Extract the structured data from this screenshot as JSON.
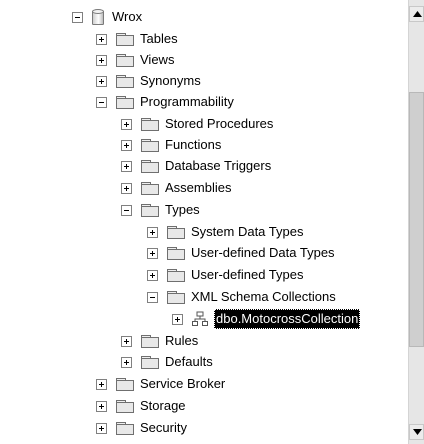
{
  "tree": {
    "root": {
      "label": "Wrox"
    },
    "items": [
      {
        "label": "Tables"
      },
      {
        "label": "Views"
      },
      {
        "label": "Synonyms"
      },
      {
        "label": "Programmability"
      },
      {
        "label": "Stored Procedures"
      },
      {
        "label": "Functions"
      },
      {
        "label": "Database Triggers"
      },
      {
        "label": "Assemblies"
      },
      {
        "label": "Types"
      },
      {
        "label": "System Data Types"
      },
      {
        "label": "User-defined Data Types"
      },
      {
        "label": "User-defined Types"
      },
      {
        "label": "XML Schema Collections"
      },
      {
        "label": "dbo.MotocrossCollection"
      },
      {
        "label": "Rules"
      },
      {
        "label": "Defaults"
      },
      {
        "label": "Service Broker"
      },
      {
        "label": "Storage"
      },
      {
        "label": "Security"
      }
    ]
  },
  "colors": {
    "selection_bg": "#000000",
    "selection_text": "#ffffff",
    "folder_border": "#6f6f6f"
  },
  "icons": {
    "expand": "plus-box-icon",
    "collapse": "minus-box-icon",
    "database": "database-icon",
    "folder": "folder-icon",
    "schema": "schema-collection-icon"
  }
}
